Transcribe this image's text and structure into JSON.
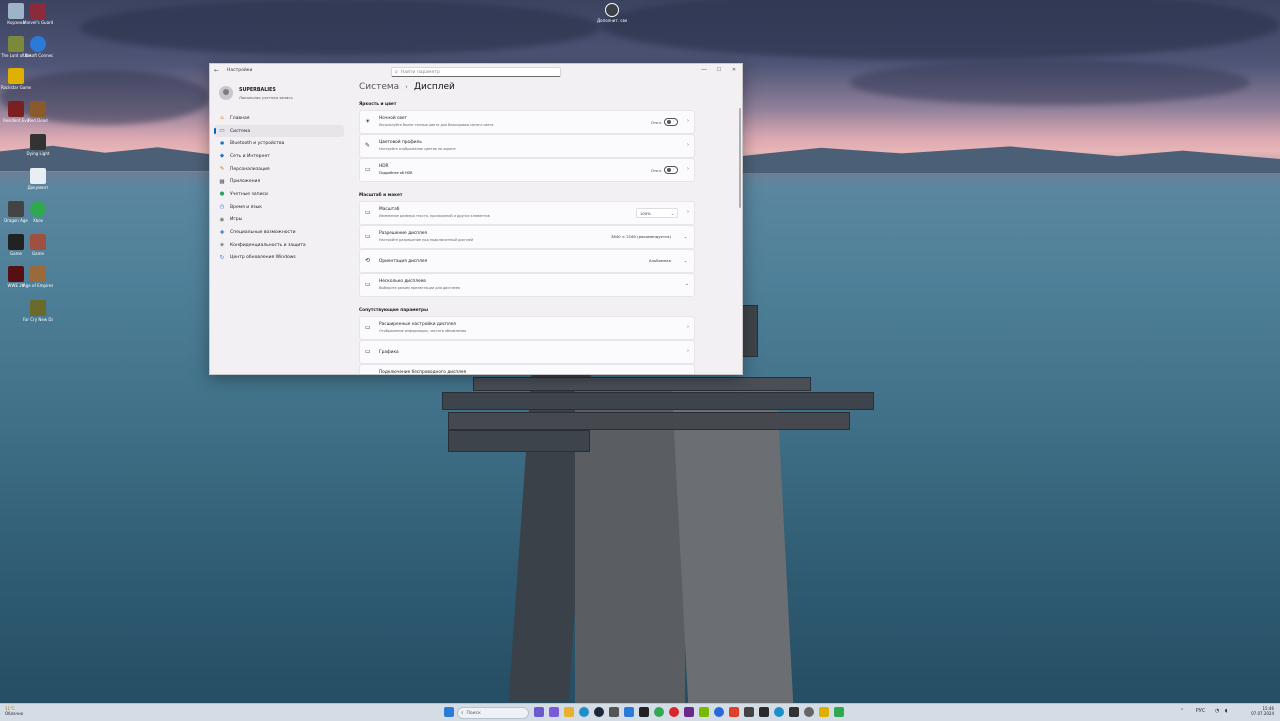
{
  "colors": {
    "accent": "#0067c0",
    "window_bg": "#f3f0f4",
    "taskbar": "#d4dde6"
  },
  "desktop": {
    "icons": [
      {
        "label": "Корзина",
        "color": "#9fb3c8"
      },
      {
        "label": "Marvel's Guardians ...",
        "color": "#8b2a3a"
      },
      {
        "label": "The Lord of the Rings",
        "color": "#7a8a3a"
      },
      {
        "label": "Ubisoft Connect",
        "color": "#2a7ad8"
      },
      {
        "label": "Rockstar Games Launcher",
        "color": "#e0b000"
      },
      {
        "label": "Resident Evil",
        "color": "#7a2020"
      },
      {
        "label": "Red Dead",
        "color": "#8a5a2a"
      },
      {
        "label": "Dying Light",
        "color": "#333333"
      },
      {
        "label": "Документ",
        "color": "#e8eef4"
      },
      {
        "label": "Dragon Age",
        "color": "#444444"
      },
      {
        "label": "Xbox",
        "color": "#2fa84f"
      },
      {
        "label": "Game",
        "color": "#222222"
      },
      {
        "label": "Game",
        "color": "#a05040"
      },
      {
        "label": "WWE 2K",
        "color": "#551111"
      },
      {
        "label": "Age of Empires",
        "color": "#9a6a3a"
      },
      {
        "label": "Far Cry New Dawn",
        "color": "#6a6a2a"
      }
    ],
    "top_icon": {
      "label": "Дополнит. сведения ...",
      "color": "#ffffff"
    }
  },
  "window": {
    "app_name": "Настройки",
    "search_placeholder": "Найти параметр",
    "controls": {
      "minimize": "—",
      "maximize": "☐",
      "close": "✕"
    },
    "user": {
      "name": "SUPERBALIES",
      "subtitle": "Локальная учетная запись"
    },
    "nav": [
      {
        "label": "Главная",
        "icon": "home-icon",
        "glyph": "⌂",
        "color": "#d08a30",
        "active": false
      },
      {
        "label": "Система",
        "icon": "system-icon",
        "glyph": "▭",
        "color": "#0067c0",
        "active": true
      },
      {
        "label": "Bluetooth и устройства",
        "icon": "bluetooth-icon",
        "glyph": "✱",
        "color": "#0067c0",
        "active": false
      },
      {
        "label": "Сеть и Интернет",
        "icon": "network-icon",
        "glyph": "◆",
        "color": "#2a6ac0",
        "active": false
      },
      {
        "label": "Персонализация",
        "icon": "brush-icon",
        "glyph": "✎",
        "color": "#c07a30",
        "active": false
      },
      {
        "label": "Приложения",
        "icon": "apps-icon",
        "glyph": "▦",
        "color": "#555555",
        "active": false
      },
      {
        "label": "Учетные записи",
        "icon": "accounts-icon",
        "glyph": "●",
        "color": "#2aa060",
        "active": false
      },
      {
        "label": "Время и язык",
        "icon": "time-language-icon",
        "glyph": "◷",
        "color": "#2a7ad8",
        "active": false
      },
      {
        "label": "Игры",
        "icon": "games-icon",
        "glyph": "◉",
        "color": "#777777",
        "active": false
      },
      {
        "label": "Специальные возможности",
        "icon": "accessibility-icon",
        "glyph": "✚",
        "color": "#2a6ac0",
        "active": false
      },
      {
        "label": "Конфиденциальность и защита",
        "icon": "shield-icon",
        "glyph": "◈",
        "color": "#777777",
        "active": false
      },
      {
        "label": "Центр обновления Windows",
        "icon": "update-icon",
        "glyph": "↻",
        "color": "#2a7ad8",
        "active": false
      }
    ],
    "breadcrumb": {
      "parent": "Система",
      "separator": "›",
      "current": "Дисплей"
    },
    "sections": {
      "brightness": "Яркость и цвет",
      "scale": "Масштаб и макет",
      "related": "Сопутствующие параметры"
    },
    "rows": {
      "night_light": {
        "title": "Ночной свет",
        "subtitle": "Используйте более теплые цвета для блокировки синего света",
        "value": "Откл.",
        "icon": "☀"
      },
      "color_profile": {
        "title": "Цветовой профиль",
        "subtitle": "Настройте отображение цветов на экране",
        "icon": "✎"
      },
      "hdr": {
        "title": "HDR",
        "subtitle": "Подробнее об HDR",
        "value": "Откл.",
        "icon": "▭"
      },
      "scale": {
        "title": "Масштаб",
        "subtitle": "Изменение размера текста, приложений и других элементов",
        "value": "100%",
        "icon": "▭"
      },
      "resolution": {
        "title": "Разрешение дисплея",
        "subtitle": "Настройте разрешение под подключенный дисплей",
        "value": "3840 × 2160 (рекомендуется)",
        "icon": "▭"
      },
      "orientation": {
        "title": "Ориентация дисплея",
        "value": "Альбомная",
        "icon": "⟲"
      },
      "multiple": {
        "title": "Несколько дисплеев",
        "subtitle": "Выберите режим презентации для дисплеев",
        "icon": "▭"
      },
      "advanced": {
        "title": "Расширенные настройки дисплея",
        "subtitle": "Отображение информации, частота обновления",
        "icon": "▭"
      },
      "graphics": {
        "title": "Графика",
        "icon": "▭"
      },
      "partial": {
        "title": "Подключение беспроводного дисплея"
      }
    }
  },
  "taskbar": {
    "weather_temp": "11°C",
    "weather_text": "Облачно",
    "search_placeholder": "Поиск",
    "time": "15:46",
    "date": "07.07.2024",
    "lang": "РУС",
    "apps": [
      {
        "name": "start-icon",
        "color": "#2a7ad8"
      },
      {
        "name": "taskview-icon",
        "color": "#333333"
      },
      {
        "name": "widgets-icon",
        "color": "#6a5acd"
      },
      {
        "name": "chat-icon",
        "color": "#7a5ad8"
      },
      {
        "name": "explorer-icon",
        "color": "#e8b030"
      },
      {
        "name": "edge-icon",
        "color": "#1e90c8"
      },
      {
        "name": "steam-icon",
        "color": "#1b2838"
      },
      {
        "name": "settings-icon",
        "color": "#555555"
      },
      {
        "name": "store-icon",
        "color": "#2a7ad8"
      },
      {
        "name": "epic-icon",
        "color": "#222222"
      },
      {
        "name": "chrome-icon",
        "color": "#34a853"
      },
      {
        "name": "opera-icon",
        "color": "#d8262c"
      },
      {
        "name": "gog-icon",
        "color": "#6a2a8a"
      },
      {
        "name": "nvidia-icon",
        "color": "#76b900"
      },
      {
        "name": "ubisoft-icon",
        "color": "#2a6ad8"
      },
      {
        "name": "ea-icon",
        "color": "#e0402a"
      },
      {
        "name": "media-icon",
        "color": "#444444"
      },
      {
        "name": "rockstar-icon",
        "color": "#e0b000"
      },
      {
        "name": "xbox-icon",
        "color": "#2fa84f"
      }
    ]
  }
}
